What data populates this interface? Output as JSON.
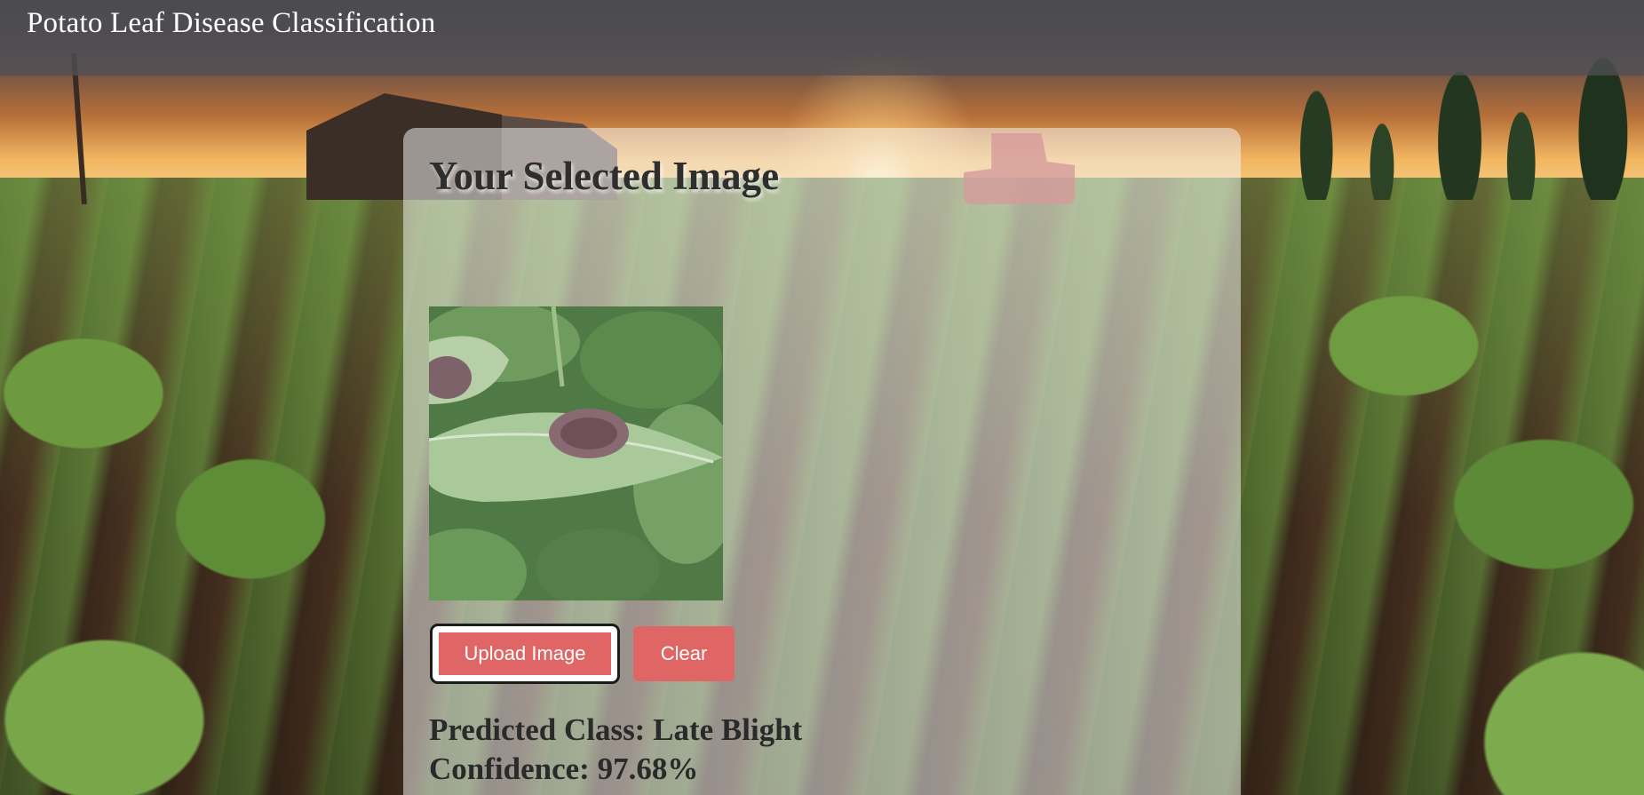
{
  "header": {
    "title": "Potato Leaf Disease Classification"
  },
  "card": {
    "heading": "Your Selected Image",
    "upload_label": "Upload Image",
    "clear_label": "Clear"
  },
  "result": {
    "predicted_label": "Predicted Class:",
    "predicted_value": "Late Blight",
    "confidence_label": "Confidence:",
    "confidence_value": "97.68%"
  },
  "colors": {
    "button": "#e06666",
    "header_bg": "#505054"
  }
}
